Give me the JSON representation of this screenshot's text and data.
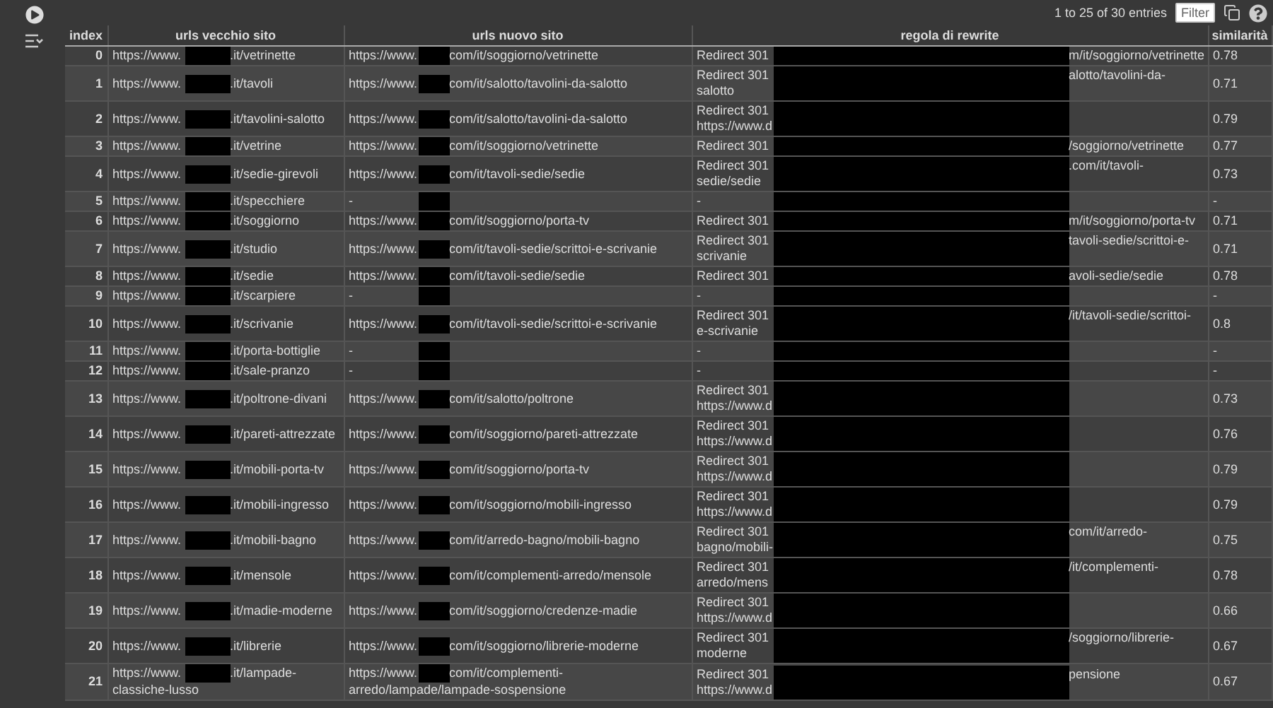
{
  "toolbar": {
    "entries": "1 to 25 of 30 entries",
    "filter_button": "Filter"
  },
  "table": {
    "columns": [
      "index",
      "urls vecchio sito",
      "urls nuovo sito",
      "regola di rewrite",
      "similarità"
    ],
    "rows": [
      {
        "index": "0",
        "old": {
          "head": "https://www.",
          "tail": ".it/vetrinette"
        },
        "new": {
          "head": "https://www.",
          "tail": "com/it/soggiorno/vetrinette"
        },
        "rule": {
          "head": "Redirect 301",
          "tail": "m/it/soggiorno/vetrinette"
        },
        "similarity": "0.78"
      },
      {
        "index": "1",
        "old": {
          "head": "https://www.",
          "tail": ".it/tavoli"
        },
        "new": {
          "head": "https://www.",
          "tail": "com/it/salotto/tavolini-da-salotto"
        },
        "rule": {
          "head": "Redirect 301\nsalotto",
          "tail": "alotto/tavolini-da-"
        },
        "similarity": "0.71"
      },
      {
        "index": "2",
        "old": {
          "head": "https://www.",
          "tail": ".it/tavolini-salotto"
        },
        "new": {
          "head": "https://www.",
          "tail": "com/it/salotto/tavolini-da-salotto"
        },
        "rule": {
          "head": "Redirect 301\nhttps://www.d"
        },
        "similarity": "0.79"
      },
      {
        "index": "3",
        "old": {
          "head": "https://www.",
          "tail": ".it/vetrine"
        },
        "new": {
          "head": "https://www.",
          "tail": "com/it/soggiorno/vetrinette"
        },
        "rule": {
          "head": "Redirect 301",
          "tail": "/soggiorno/vetrinette"
        },
        "similarity": "0.77"
      },
      {
        "index": "4",
        "old": {
          "head": "https://www.",
          "tail": ".it/sedie-girevoli"
        },
        "new": {
          "head": "https://www.",
          "tail": "com/it/tavoli-sedie/sedie"
        },
        "rule": {
          "head": "Redirect 301\nsedie/sedie",
          "tail": ".com/it/tavoli-"
        },
        "similarity": "0.73"
      },
      {
        "index": "5",
        "old": {
          "head": "https://www.",
          "tail": ".it/specchiere"
        },
        "new": {
          "head": "-"
        },
        "rule": {
          "head": "-"
        },
        "similarity": "-"
      },
      {
        "index": "6",
        "old": {
          "head": "https://www.",
          "tail": ".it/soggiorno"
        },
        "new": {
          "head": "https://www.",
          "tail": "com/it/soggiorno/porta-tv"
        },
        "rule": {
          "head": "Redirect 301",
          "tail": "m/it/soggiorno/porta-tv"
        },
        "similarity": "0.71"
      },
      {
        "index": "7",
        "old": {
          "head": "https://www.",
          "tail": ".it/studio"
        },
        "new": {
          "head": "https://www.",
          "tail": "com/it/tavoli-sedie/scrittoi-e-scrivanie"
        },
        "rule": {
          "head": "Redirect 301\nscrivanie",
          "tail": "tavoli-sedie/scrittoi-e-"
        },
        "similarity": "0.71"
      },
      {
        "index": "8",
        "old": {
          "head": "https://www.",
          "tail": ".it/sedie"
        },
        "new": {
          "head": "https://www.",
          "tail": "com/it/tavoli-sedie/sedie"
        },
        "rule": {
          "head": "Redirect 301",
          "tail": "avoli-sedie/sedie"
        },
        "similarity": "0.78"
      },
      {
        "index": "9",
        "old": {
          "head": "https://www.",
          "tail": ".it/scarpiere"
        },
        "new": {
          "head": "-"
        },
        "rule": {
          "head": "-"
        },
        "similarity": "-"
      },
      {
        "index": "10",
        "old": {
          "head": "https://www.",
          "tail": ".it/scrivanie"
        },
        "new": {
          "head": "https://www.",
          "tail": "com/it/tavoli-sedie/scrittoi-e-scrivanie"
        },
        "rule": {
          "head": "Redirect 301\ne-scrivanie",
          "tail": "/it/tavoli-sedie/scrittoi-"
        },
        "similarity": "0.8"
      },
      {
        "index": "11",
        "old": {
          "head": "https://www.",
          "tail": ".it/porta-bottiglie"
        },
        "new": {
          "head": "-"
        },
        "rule": {
          "head": "-"
        },
        "similarity": "-"
      },
      {
        "index": "12",
        "old": {
          "head": "https://www.",
          "tail": ".it/sale-pranzo"
        },
        "new": {
          "head": "-"
        },
        "rule": {
          "head": "-"
        },
        "similarity": "-"
      },
      {
        "index": "13",
        "old": {
          "head": "https://www.",
          "tail": ".it/poltrone-divani"
        },
        "new": {
          "head": "https://www.",
          "tail": "com/it/salotto/poltrone"
        },
        "rule": {
          "head": "Redirect 301\nhttps://www.d"
        },
        "similarity": "0.73"
      },
      {
        "index": "14",
        "old": {
          "head": "https://www.",
          "tail": ".it/pareti-attrezzate"
        },
        "new": {
          "head": "https://www.",
          "tail": "com/it/soggiorno/pareti-attrezzate"
        },
        "rule": {
          "head": "Redirect 301\nhttps://www.d"
        },
        "similarity": "0.76"
      },
      {
        "index": "15",
        "old": {
          "head": "https://www.",
          "tail": ".it/mobili-porta-tv"
        },
        "new": {
          "head": "https://www.",
          "tail": "com/it/soggiorno/porta-tv"
        },
        "rule": {
          "head": "Redirect 301\nhttps://www.d"
        },
        "similarity": "0.79"
      },
      {
        "index": "16",
        "old": {
          "head": "https://www.",
          "tail": ".it/mobili-ingresso"
        },
        "new": {
          "head": "https://www.",
          "tail": "com/it/soggiorno/mobili-ingresso"
        },
        "rule": {
          "head": "Redirect 301\nhttps://www.d"
        },
        "similarity": "0.79"
      },
      {
        "index": "17",
        "old": {
          "head": "https://www.",
          "tail": ".it/mobili-bagno"
        },
        "new": {
          "head": "https://www.",
          "tail": "com/it/arredo-bagno/mobili-bagno"
        },
        "rule": {
          "head": "Redirect 301\nbagno/mobili-",
          "tail": "com/it/arredo-"
        },
        "similarity": "0.75"
      },
      {
        "index": "18",
        "old": {
          "head": "https://www.",
          "tail": ".it/mensole"
        },
        "new": {
          "head": "https://www.",
          "tail": "com/it/complementi-arredo/mensole"
        },
        "rule": {
          "head": "Redirect 301\narredo/mens",
          "tail": "/it/complementi-"
        },
        "similarity": "0.78"
      },
      {
        "index": "19",
        "old": {
          "head": "https://www.",
          "tail": ".it/madie-moderne"
        },
        "new": {
          "head": "https://www.",
          "tail": "com/it/soggiorno/credenze-madie"
        },
        "rule": {
          "head": "Redirect 301\nhttps://www.d"
        },
        "similarity": "0.66"
      },
      {
        "index": "20",
        "old": {
          "head": "https://www.",
          "tail": ".it/librerie"
        },
        "new": {
          "head": "https://www.",
          "tail": "com/it/soggiorno/librerie-moderne"
        },
        "rule": {
          "head": "Redirect 301\nmoderne",
          "tail": "/soggiorno/librerie-"
        },
        "similarity": "0.67"
      },
      {
        "index": "21",
        "old": {
          "head": "https://www.",
          "tail": ".it/lampade-",
          "line2": "classiche-lusso"
        },
        "new": {
          "head": "https://www.",
          "tail": "com/it/complementi-",
          "line2": "arredo/lampade/lampade-sospensione"
        },
        "rule": {
          "head": "Redirect 301\nhttps://www.d",
          "tail": "pensione"
        },
        "similarity": "0.67"
      }
    ]
  }
}
